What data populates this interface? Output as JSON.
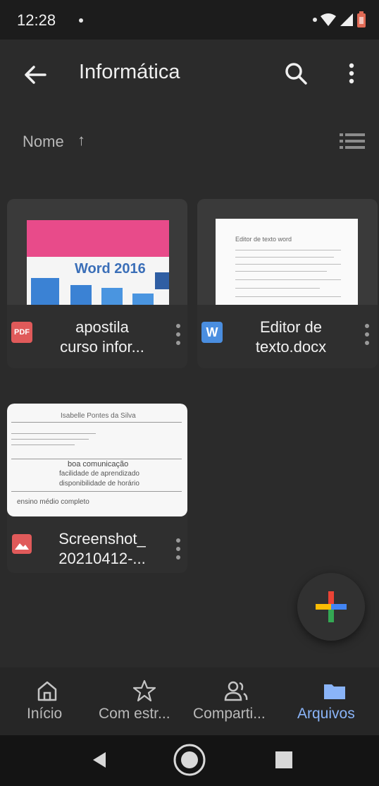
{
  "status_bar": {
    "time": "12:28"
  },
  "app_bar": {
    "title": "Informática"
  },
  "sort": {
    "label": "Nome",
    "arrow": "↑"
  },
  "files": [
    {
      "name_line1": "apostila",
      "name_line2": "curso infor...",
      "type": "PDF",
      "thumb_text": "Word 2016"
    },
    {
      "name_line1": "Editor de",
      "name_line2": "texto.docx",
      "type": "W",
      "thumb_text": "Editor de texto word"
    },
    {
      "name_line1": "Screenshot_",
      "name_line2": "20210412-...",
      "type": "image",
      "thumb_lines": [
        "Isabelle Pontes da Silva",
        "boa comunicação",
        "facilidade de aprendizado",
        "disponibilidade de horário",
        "ensino médio completo"
      ]
    }
  ],
  "bottom_nav": [
    {
      "label": "Início",
      "icon": "home-icon",
      "active": false
    },
    {
      "label": "Com estr...",
      "icon": "star-icon",
      "active": false
    },
    {
      "label": "Comparti...",
      "icon": "shared-icon",
      "active": false
    },
    {
      "label": "Arquivos",
      "icon": "folder-icon",
      "active": true
    }
  ],
  "colors": {
    "accent": "#8ab4f8",
    "background": "#2b2b2b",
    "pdf": "#e05a5a",
    "word": "#4a8ee0",
    "image": "#e05a5a"
  }
}
